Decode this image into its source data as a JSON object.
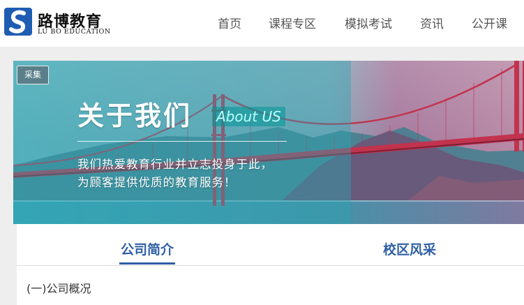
{
  "header": {
    "logo_title": "路博教育",
    "logo_subtitle": "LU BO EDUCATION",
    "nav": [
      {
        "label": "首页"
      },
      {
        "label": "课程专区"
      },
      {
        "label": "模拟考试"
      },
      {
        "label": "资讯"
      },
      {
        "label": "公开课"
      }
    ]
  },
  "banner": {
    "tag": "采集",
    "title": "关于我们",
    "title_en": "About US",
    "line1": "我们热爱教育行业并立志投身于此，",
    "line2": "为顾客提供优质的教育服务！"
  },
  "tabs": [
    {
      "label": "公司简介",
      "active": true
    },
    {
      "label": "校区风采",
      "active": false
    }
  ],
  "content": {
    "section_heading": "(一)公司概况"
  },
  "colors": {
    "brand_blue": "#2f5fa5",
    "logo_blue": "#1f5db3",
    "teal_overlay": "#2aa5b0",
    "bridge_red": "#c2334e"
  }
}
